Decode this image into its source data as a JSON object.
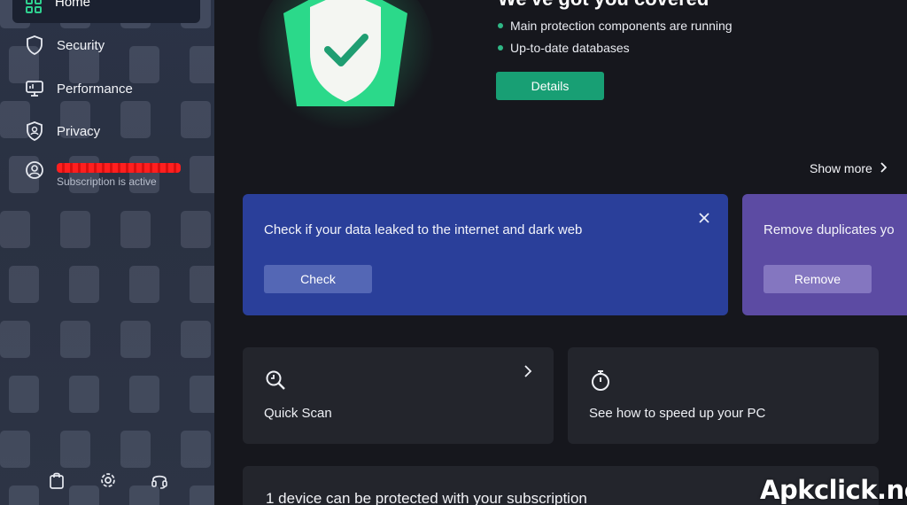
{
  "sidebar": {
    "items": [
      {
        "label": "Home",
        "icon": "home-icon"
      },
      {
        "label": "Security",
        "icon": "shield-icon"
      },
      {
        "label": "Performance",
        "icon": "monitor-icon"
      },
      {
        "label": "Privacy",
        "icon": "privacy-shield-icon"
      }
    ],
    "account": {
      "subscription_status": "Subscription is active",
      "icon": "user-circle-icon"
    },
    "bottom_icons": [
      "store-bag-icon",
      "settings-gear-icon",
      "support-headset-icon"
    ]
  },
  "hero": {
    "heading": "We've got you covered",
    "status_items": [
      "Main protection components are running",
      "Up-to-date databases"
    ],
    "details_label": "Details",
    "accent": "#189f74"
  },
  "show_more_label": "Show more",
  "promos": [
    {
      "text": "Check if your data leaked to the internet and dark web",
      "button": "Check",
      "color": "#2a3f9a"
    },
    {
      "text": "Remove duplicates yo",
      "button": "Remove",
      "color": "#5c4ba3"
    }
  ],
  "tiles": [
    {
      "label": "Quick Scan",
      "icon": "quick-scan-icon"
    },
    {
      "label": "See how to speed up your PC",
      "icon": "stopwatch-icon"
    }
  ],
  "device_card": {
    "text": "1 device can be protected with your subscription"
  },
  "watermark": "Apkclick.net"
}
